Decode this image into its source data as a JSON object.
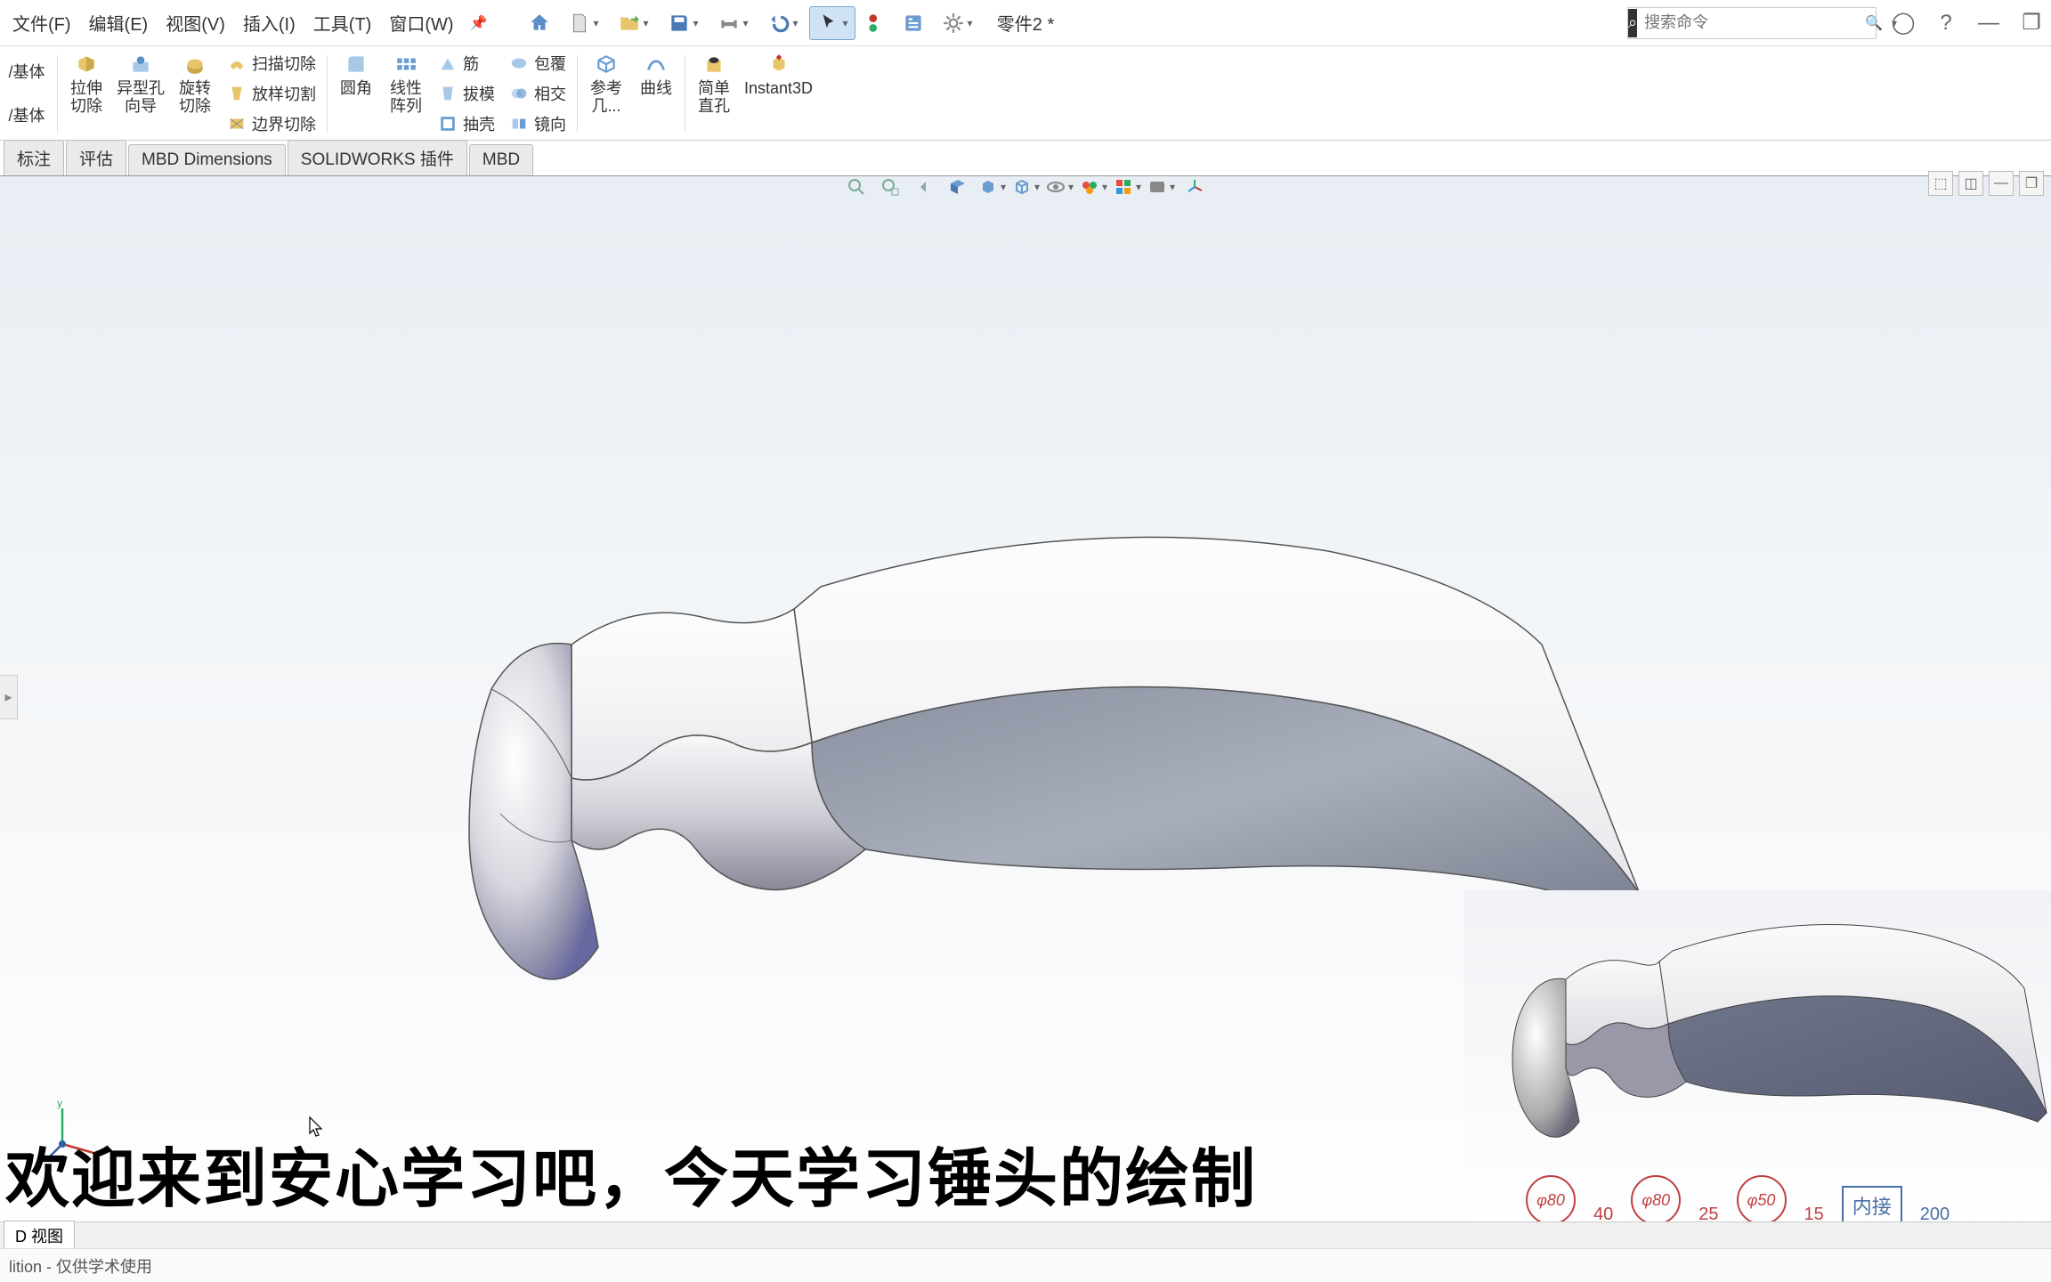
{
  "menu": {
    "file": "文件(F)",
    "edit": "编辑(E)",
    "view": "视图(V)",
    "insert": "插入(I)",
    "tools": "工具(T)",
    "window": "窗口(W)"
  },
  "document_title": "零件2 *",
  "search": {
    "placeholder": "搜索命令"
  },
  "ribbon": {
    "base1": "/基体",
    "base2": "/基体",
    "extrude_cut": "拉伸\n切除",
    "hole_wizard": "异型孔\n向导",
    "revolve_cut": "旋转\n切除",
    "loft_cut": "放样切割",
    "sweep_cut": "扫描切除",
    "boundary_cut": "边界切除",
    "fillet": "圆角",
    "linear_pattern": "线性\n阵列",
    "rib": "筋",
    "draft": "拔模",
    "shell": "抽壳",
    "wrap": "包覆",
    "intersect": "相交",
    "mirror": "镜向",
    "ref_geom": "参考\n几...",
    "curves": "曲线",
    "simple_hole": "简单\n直孔",
    "instant3d": "Instant3D"
  },
  "tabs": {
    "annotate": "标注",
    "evaluate": "评估",
    "mbd_dim": "MBD Dimensions",
    "sw_addins": "SOLIDWORKS 插件",
    "mbd": "MBD"
  },
  "caption_text": "欢迎来到安心学习吧，今天学习锤头的绘制",
  "bottom_tab": "D 视图",
  "status_text": "lition - 仅供学术使用",
  "annotations": {
    "c1": "φ80",
    "t1": "40",
    "c2": "φ80",
    "t2": "25",
    "c3": "φ50",
    "t3": "15",
    "box": "内接",
    "t4": "200"
  }
}
